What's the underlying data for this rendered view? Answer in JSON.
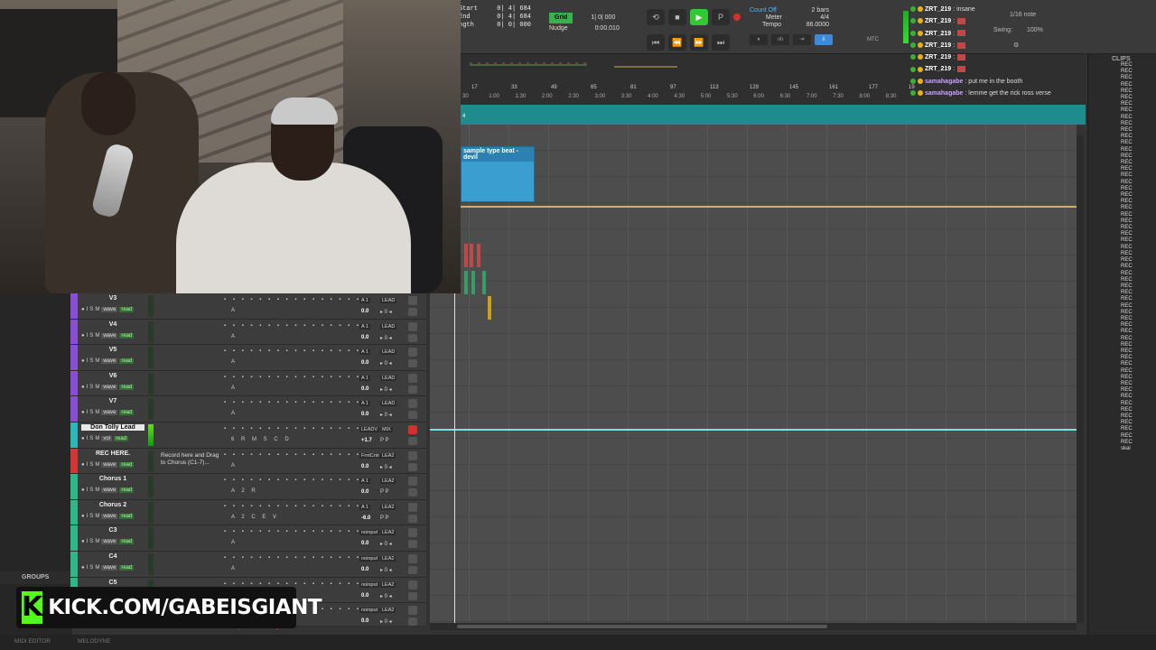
{
  "transport": {
    "counter": [
      {
        "label": "Start",
        "value": "0| 4| 684"
      },
      {
        "label": "End",
        "value": "0| 4| 684"
      },
      {
        "label": "ngth",
        "value": "0| 0| 000"
      }
    ],
    "grid_label": "Grid",
    "grid_value": "1| 0| 000",
    "nudge_label": "Nudge",
    "nudge_value": "0:00.010",
    "count_off": "Count Off",
    "count_off_value": "2 bars",
    "meter_label": "Meter",
    "meter_value": "4/4",
    "tempo_label": "Tempo",
    "tempo_value": "86.0000",
    "mtc": "MTC",
    "note_value": "1/16 note",
    "swing_label": "Swing:",
    "swing_value": "100%"
  },
  "chat": [
    {
      "user": "ZRT_219",
      "text": ": insane"
    },
    {
      "user": "ZRT_219",
      "text": ":"
    },
    {
      "user": "ZRT_219",
      "text": ":"
    },
    {
      "user": "ZRT_219",
      "text": ":"
    },
    {
      "user": "ZRT_219",
      "text": ":"
    },
    {
      "user": "ZRT_219",
      "text": ":"
    },
    {
      "user": "samahagabe",
      "text": ": put me in the booth"
    },
    {
      "user": "samahagabe",
      "text": ": lemme get the rick ross verse"
    }
  ],
  "ruler": {
    "bars": [
      "17",
      "33",
      "49",
      "65",
      "81",
      "97",
      "113",
      "129",
      "145",
      "161",
      "177",
      "19"
    ],
    "mins": [
      "30",
      "1:00",
      "1:30",
      "2:00",
      "2:30",
      "3:00",
      "3:30",
      "4:00",
      "4:30",
      "5:00",
      "5:30",
      "6:00",
      "6:30",
      "7:00",
      "7:30",
      "8:00",
      "8:30"
    ],
    "marker": "4"
  },
  "clip_name": "sample type beat - devil",
  "tracks": [
    {
      "name": "V3",
      "color": "#8a4fd0",
      "io1": "A 1",
      "io2": "LEAD",
      "vol": "0.0",
      "pan": "▸ 0 ◂",
      "ins": "A"
    },
    {
      "name": "V4",
      "color": "#8a4fd0",
      "io1": "A 1",
      "io2": "LEAD",
      "vol": "0.0",
      "pan": "▸ 0 ◂",
      "ins": "A"
    },
    {
      "name": "V5",
      "color": "#8a4fd0",
      "io1": "A 1",
      "io2": "LEAD",
      "vol": "0.0",
      "pan": "▸ 0 ◂",
      "ins": "A"
    },
    {
      "name": "V6",
      "color": "#8a4fd0",
      "io1": "A 1",
      "io2": "LEAD",
      "vol": "0.0",
      "pan": "▸ 0 ◂",
      "ins": "A"
    },
    {
      "name": "V7",
      "color": "#8a4fd0",
      "io1": "A 1",
      "io2": "LEAD",
      "vol": "0.0",
      "pan": "▸ 0 ◂",
      "ins": "A"
    },
    {
      "name": "Don Tolly Lead",
      "color": "#2fb6b6",
      "io1": "LEADV",
      "io2": "MIX",
      "vol": "+1.7",
      "pan": "P P",
      "ins": "6 R M S C D",
      "selected": true,
      "view": "vol"
    },
    {
      "name": "REC HERE.",
      "color": "#d03838",
      "io1": "FrntCntr",
      "io2": "LEA2",
      "vol": "0.0",
      "pan": "▸ 0 ◂",
      "ins": "A",
      "desc": "Record here and Drag to Chorus (C1-7)..."
    },
    {
      "name": "Chorus 1",
      "color": "#2fb68a",
      "io1": "A 1",
      "io2": "LEA2",
      "vol": "0.0",
      "pan": "P P",
      "ins": "A 2 R"
    },
    {
      "name": "Chorus 2",
      "color": "#2fb68a",
      "io1": "A 1",
      "io2": "LEA2",
      "vol": "-6.0",
      "pan": "P P",
      "ins": "A 2 C E V"
    },
    {
      "name": "C3",
      "color": "#2fb68a",
      "io1": "noinput",
      "io2": "LEA2",
      "vol": "0.0",
      "pan": "▸ 0 ◂",
      "ins": "A"
    },
    {
      "name": "C4",
      "color": "#2fb68a",
      "io1": "noinput",
      "io2": "LEA2",
      "vol": "0.0",
      "pan": "▸ 0 ◂",
      "ins": "A"
    },
    {
      "name": "C5",
      "color": "#2fb68a",
      "io1": "noinput",
      "io2": "LEA2",
      "vol": "0.0",
      "pan": "▸ 0 ◂",
      "ins": "A"
    },
    {
      "name": "",
      "color": "#2fb68a",
      "io1": "noinput",
      "io2": "LEA2",
      "vol": "0.0",
      "pan": "▸ 0 ◂",
      "ins": "A"
    }
  ],
  "track_buttons": {
    "i": "I",
    "s": "S",
    "m": "M",
    "view": "wave",
    "read": "read"
  },
  "groups": "GROUPS",
  "clips_header": "CLIPS",
  "clips_items": [
    "REC",
    "REC",
    "REC",
    "REC",
    "REC",
    "REC",
    "REC",
    "REC",
    "REC",
    "REC",
    "REC",
    "REC",
    "REC",
    "REC",
    "REC",
    "REC",
    "REC",
    "REC",
    "REC",
    "REC",
    "REC",
    "REC",
    "REC",
    "REC",
    "REC",
    "REC",
    "REC",
    "REC",
    "REC",
    "REC",
    "REC",
    "REC",
    "REC",
    "REC",
    "REC",
    "REC",
    "REC",
    "REC",
    "REC",
    "REC",
    "REC",
    "REC",
    "REC",
    "REC",
    "REC",
    "REC",
    "REC",
    "REC",
    "REC",
    "REC",
    "REC",
    "REC",
    "REC",
    "REC",
    "REC",
    "REC",
    "REC",
    "REC",
    "REC",
    "skai"
  ],
  "kick_logo": "K",
  "kick_url": "KICK.COM/GABEISGIANT",
  "transport_status": "transport record ready",
  "bottom_tabs": [
    "MIDI EDITOR",
    "MELODYNE"
  ]
}
